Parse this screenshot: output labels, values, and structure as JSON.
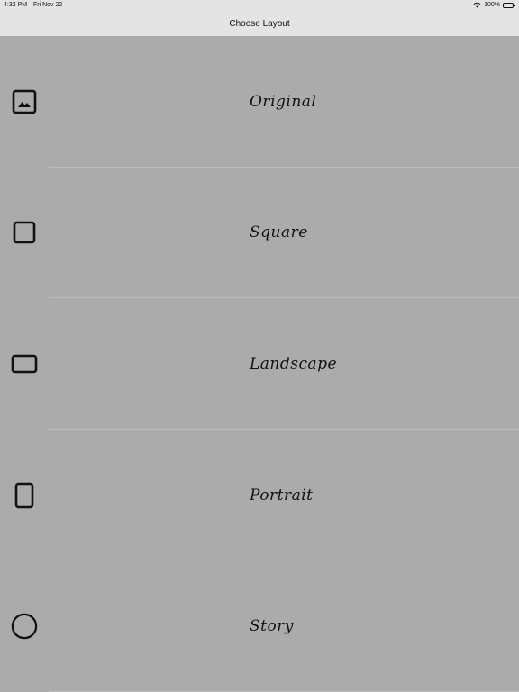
{
  "status_bar": {
    "time": "4:32 PM",
    "date": "Fri Nov 22",
    "battery": "100%"
  },
  "nav": {
    "title": "Choose Layout"
  },
  "layouts": [
    {
      "label": "Original",
      "icon": "photo-icon"
    },
    {
      "label": "Square",
      "icon": "square-icon"
    },
    {
      "label": "Landscape",
      "icon": "landscape-rect-icon"
    },
    {
      "label": "Portrait",
      "icon": "portrait-rect-icon"
    },
    {
      "label": "Story",
      "icon": "circle-icon"
    }
  ]
}
